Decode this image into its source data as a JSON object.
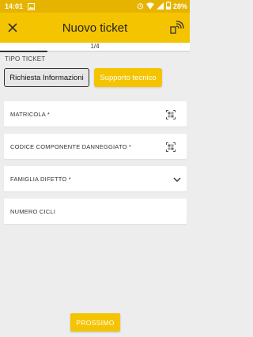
{
  "status_bar": {
    "time": "14:01",
    "battery": "28%",
    "icons": [
      "image-icon",
      "alarm-icon",
      "wifi-icon",
      "signal-icon",
      "battery-icon"
    ]
  },
  "app_bar": {
    "title": "Nuovo ticket",
    "close_icon": "close-icon",
    "rfid_icon": "nfc-icon"
  },
  "wizard": {
    "step_label": "1/4",
    "progress_fraction": 0.25
  },
  "ticket_type": {
    "label": "TIPO TICKET",
    "options": [
      {
        "label": "Richiesta Informazioni",
        "selected": true
      },
      {
        "label": "Supporto tecnico",
        "selected": false
      }
    ]
  },
  "form": {
    "fields": [
      {
        "label": "MATRICOLA *",
        "icon": "qr-scan-icon"
      },
      {
        "label": "CODICE COMPONENTE DANNEGGIATO *",
        "icon": "qr-scan-icon"
      },
      {
        "label": "FAMIGLIA DIFETTO *",
        "icon": "chevron-down-icon"
      },
      {
        "label": "NUMERO CICLI",
        "icon": ""
      }
    ]
  },
  "footer": {
    "next_label": "PROSSIMO"
  },
  "colors": {
    "accent": "#f5c400",
    "status_bar": "#e6b400",
    "background": "#ededed"
  }
}
